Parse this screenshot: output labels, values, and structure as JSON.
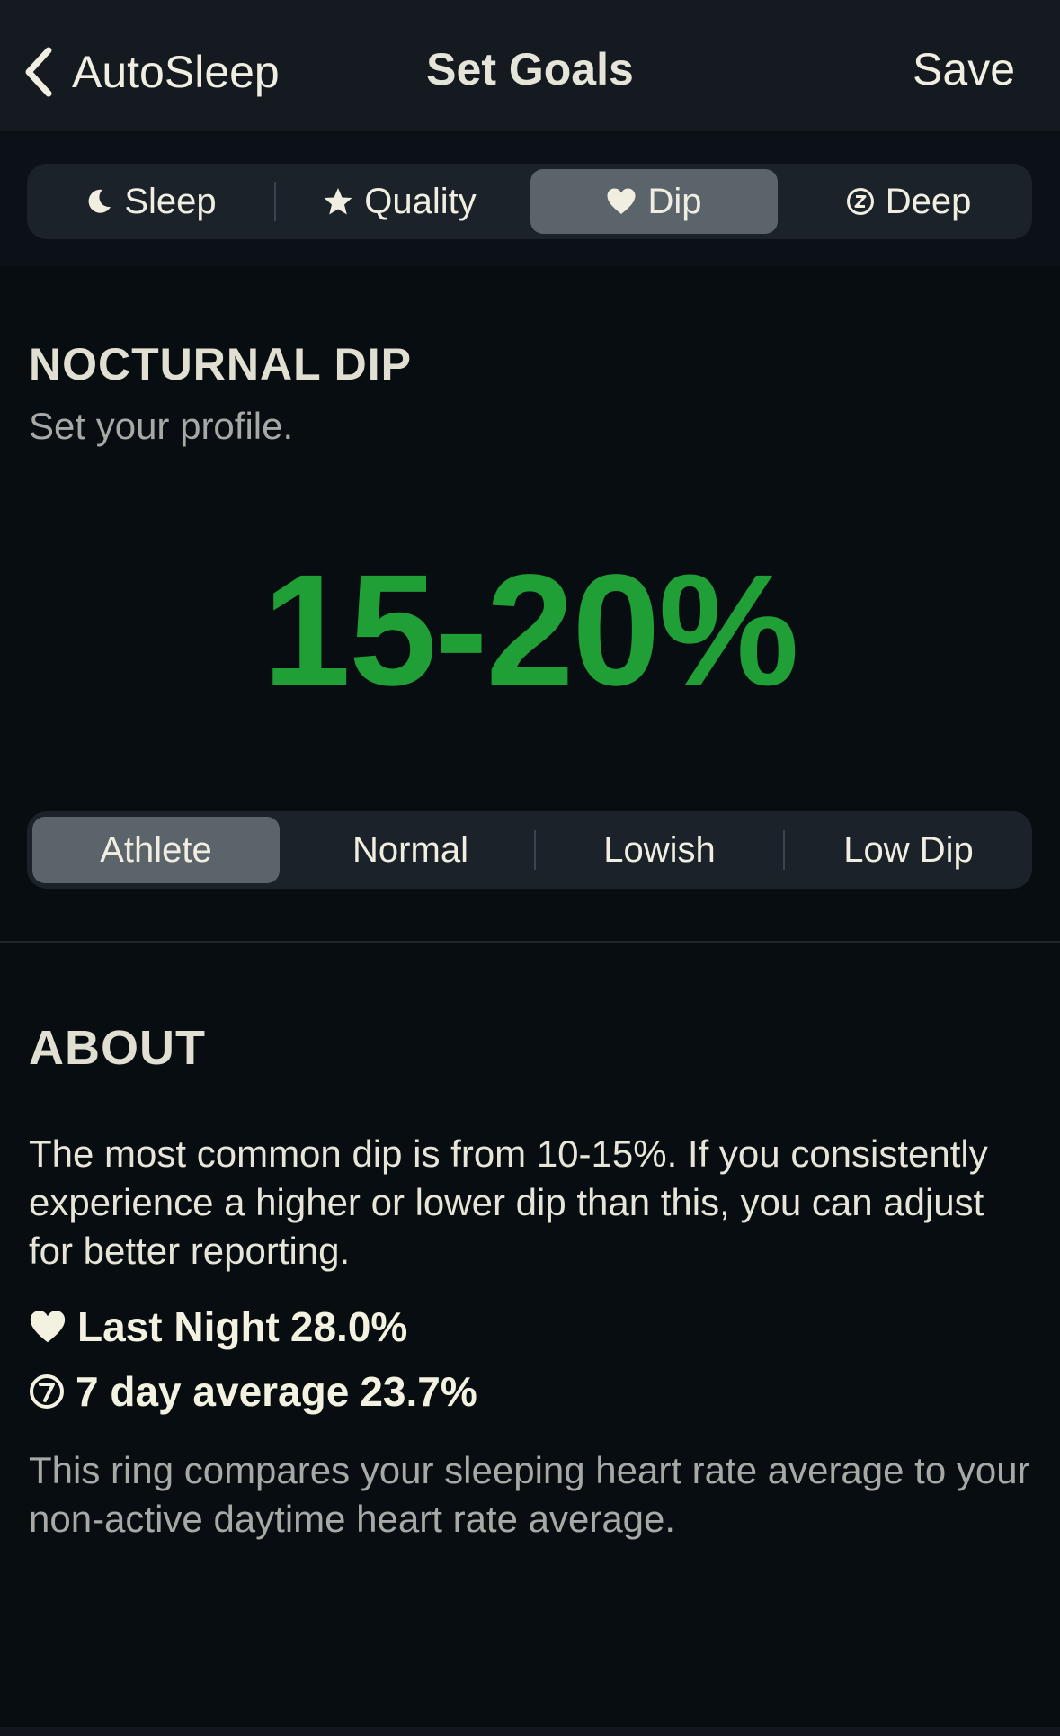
{
  "nav": {
    "back_label": "AutoSleep",
    "title": "Set Goals",
    "save_label": "Save"
  },
  "goal_tabs": [
    {
      "label": "Sleep",
      "icon": "moon-icon",
      "active": false
    },
    {
      "label": "Quality",
      "icon": "star-icon",
      "active": false
    },
    {
      "label": "Dip",
      "icon": "heart-icon",
      "active": true
    },
    {
      "label": "Deep",
      "icon": "circled-z-icon",
      "active": false
    }
  ],
  "section": {
    "title": "NOCTURNAL DIP",
    "subtitle": "Set your profile.",
    "value": "15-20%"
  },
  "profiles": [
    {
      "label": "Athlete",
      "active": true
    },
    {
      "label": "Normal",
      "active": false
    },
    {
      "label": "Lowish",
      "active": false
    },
    {
      "label": "Low Dip",
      "active": false
    }
  ],
  "about": {
    "title": "ABOUT",
    "body": "The most common dip is from 10-15%. If you consistently experience a higher or lower dip than this, you can adjust for better reporting.",
    "last_night_label": "Last Night",
    "last_night_value": "28.0%",
    "avg_label": "7 day average",
    "avg_value": "23.7%",
    "footer": "This ring compares your sleeping heart rate average to your non-active daytime heart rate average."
  },
  "colors": {
    "accent_green": "#1f9f35",
    "background": "#070d10",
    "segment_bg": "#1b2229",
    "segment_active": "#5b636b"
  }
}
